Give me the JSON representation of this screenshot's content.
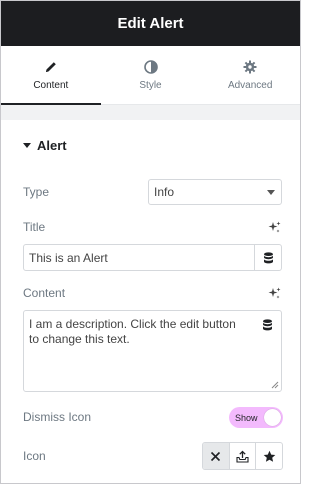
{
  "header": {
    "title": "Edit Alert"
  },
  "tabs": [
    {
      "label": "Content",
      "icon": "pencil-icon",
      "active": true
    },
    {
      "label": "Style",
      "icon": "half-circle-icon",
      "active": false
    },
    {
      "label": "Advanced",
      "icon": "gear-icon",
      "active": false
    }
  ],
  "section": {
    "title": "Alert"
  },
  "type_field": {
    "label": "Type",
    "value": "Info"
  },
  "title_field": {
    "label": "Title",
    "value": "This is an Alert"
  },
  "content_field": {
    "label": "Content",
    "value": "I am a description. Click the edit button to change this text."
  },
  "dismiss_field": {
    "label": "Dismiss Icon",
    "toggle_text": "Show",
    "on": true
  },
  "icon_field": {
    "label": "Icon",
    "options": [
      "close-icon",
      "upload-icon",
      "star-icon"
    ],
    "selected": "close-icon"
  },
  "colors": {
    "header_bg": "#1c1d20",
    "toggle_bg": "#f3bafd"
  }
}
